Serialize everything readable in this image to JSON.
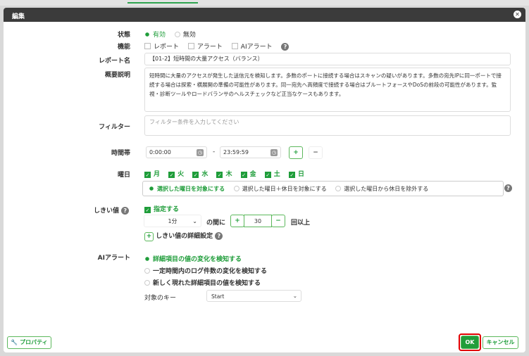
{
  "dialog": {
    "title": "編集",
    "close_icon": "close-icon"
  },
  "status": {
    "label": "状態",
    "options": [
      "有効",
      "無効"
    ],
    "selected": 0
  },
  "features": {
    "label": "機能",
    "options": [
      "レポート",
      "アラート",
      "AIアラート"
    ]
  },
  "report_name": {
    "label": "レポート名",
    "value": "【01-2】短時間の大量アクセス（バランス）"
  },
  "description": {
    "label": "概要説明",
    "value": "短時間に大量のアクセスが発生した送信元を検知します。多数のポートに接続する場合はスキャンの疑いがあります。多数の宛先IPに同一ポートで接続する場合は探索・横展開の準備の可能性があります。同一宛先へ高頻度で接続する場合はブルートフォースやDoSの前段の可能性があります。監視・診断ツールやロードバランサのヘルスチェックなど正当なケースもあります。"
  },
  "filter": {
    "label": "フィルター",
    "placeholder": "フィルター条件を入力してください"
  },
  "time_range": {
    "label": "時間帯",
    "start": "0:00:00",
    "separator": "-",
    "end": "23:59:59",
    "add": "+",
    "remove": "−"
  },
  "weekdays": {
    "label": "曜日",
    "days": [
      "月",
      "火",
      "水",
      "木",
      "金",
      "土",
      "日"
    ],
    "modes": [
      "選択した曜日を対象にする",
      "選択した曜日＋休日を対象にする",
      "選択した曜日から休日を除外する"
    ],
    "selected_mode": 0
  },
  "threshold": {
    "label": "しきい値",
    "enable_label": "指定する",
    "period": "1分",
    "between": "の間に",
    "plus": "+",
    "count": "30",
    "minus": "−",
    "suffix": "回以上",
    "detail": "しきい値の詳細設定",
    "detail_add": "+"
  },
  "ai_alert": {
    "label": "AIアラート",
    "options": [
      "詳細項目の値の変化を検知する",
      "一定時間内のログ件数の変化を検知する",
      "新しく現れた詳細項目の値を検知する"
    ],
    "selected": 0,
    "key_label": "対象のキー",
    "key_value": "Start"
  },
  "footer": {
    "properties": "プロパティ",
    "ok": "OK",
    "cancel": "キャンセル"
  },
  "colors": {
    "accent": "#1f9d3a",
    "header": "#3b3b3b",
    "highlight": "#e00000"
  }
}
